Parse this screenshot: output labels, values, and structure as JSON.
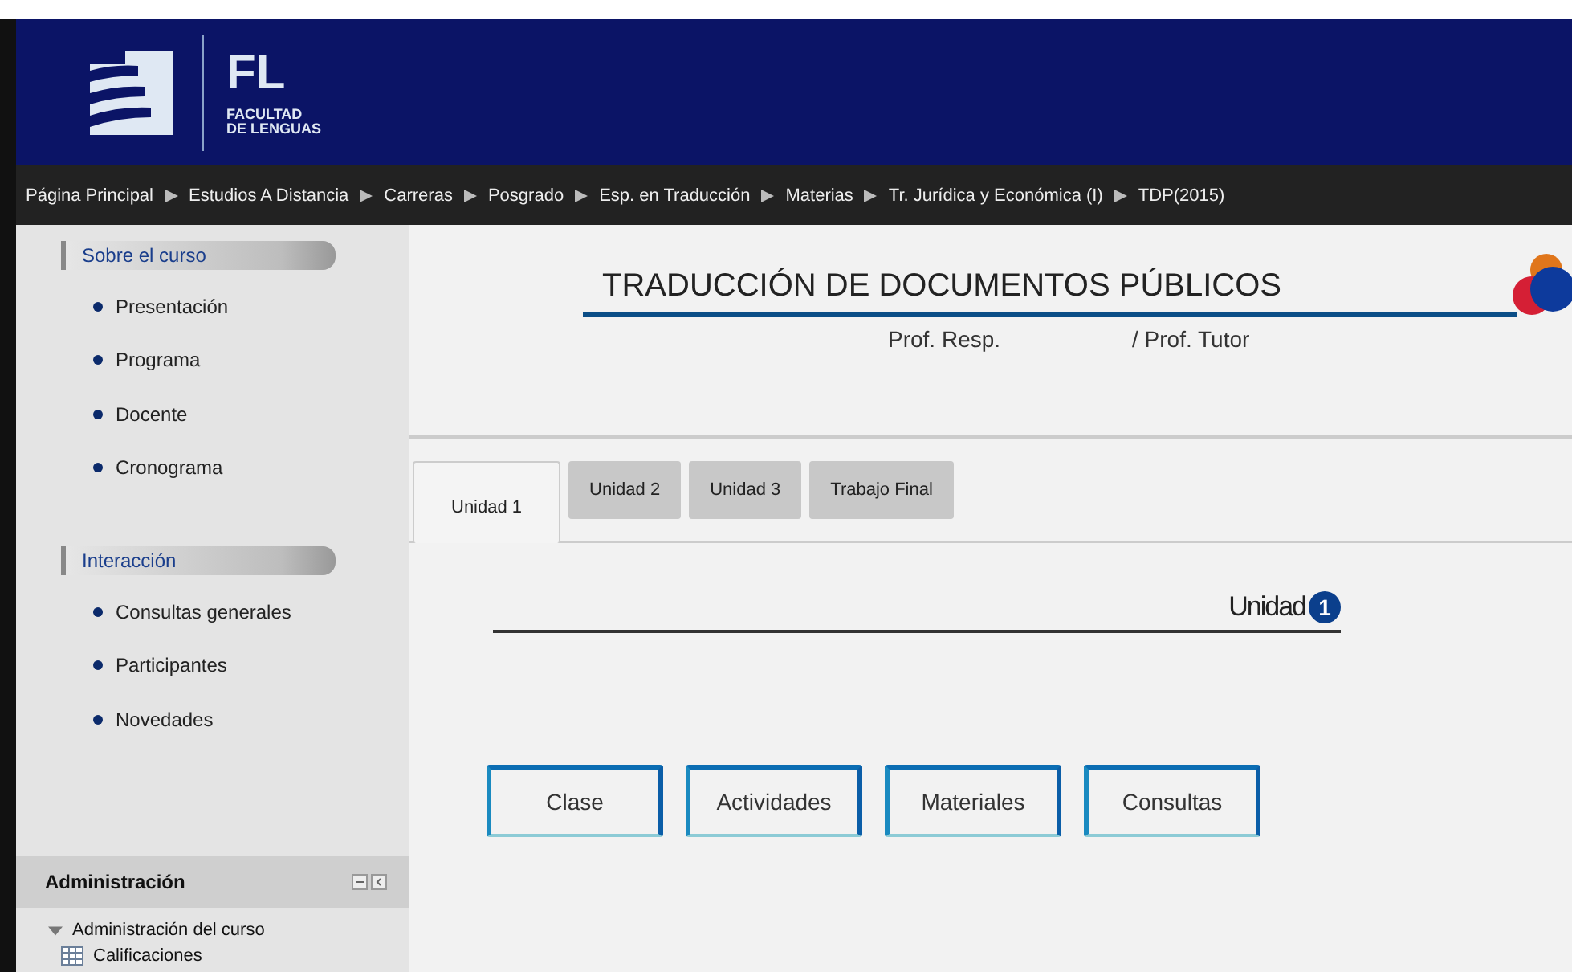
{
  "header": {
    "logo_initials": "FL",
    "logo_lines": [
      "FACULTAD",
      "DE LENGUAS"
    ]
  },
  "breadcrumb": [
    "Página Principal",
    "Estudios A Distancia",
    "Carreras",
    "Posgrado",
    "Esp. en Traducción",
    "Materias",
    "Tr. Jurídica y Económica (I)",
    "TDP(2015)"
  ],
  "sidebar": {
    "sections": [
      {
        "title": "Sobre el curso",
        "items": [
          "Presentación",
          "Programa",
          "Docente",
          "Cronograma"
        ]
      },
      {
        "title": "Interacción",
        "items": [
          "Consultas generales",
          "Participantes",
          "Novedades"
        ]
      }
    ],
    "admin": {
      "title": "Administración",
      "tree": [
        {
          "label": "Administración del curso",
          "expanded": true,
          "children": [
            {
              "label": "Calificaciones"
            }
          ]
        }
      ]
    }
  },
  "course": {
    "title": "TRADUCCIÓN DE DOCUMENTOS PÚBLICOS",
    "prof_resp": "Prof. Resp.",
    "prof_tutor": "/ Prof. Tutor"
  },
  "tabs": [
    {
      "label": "Unidad 1",
      "selected": true
    },
    {
      "label": "Unidad 2",
      "selected": false
    },
    {
      "label": "Unidad 3",
      "selected": false
    },
    {
      "label": "Trabajo Final",
      "selected": false
    }
  ],
  "unit": {
    "label": "Unidad",
    "number": "1"
  },
  "sections": [
    "Clase",
    "Actividades",
    "Materiales",
    "Consultas"
  ]
}
